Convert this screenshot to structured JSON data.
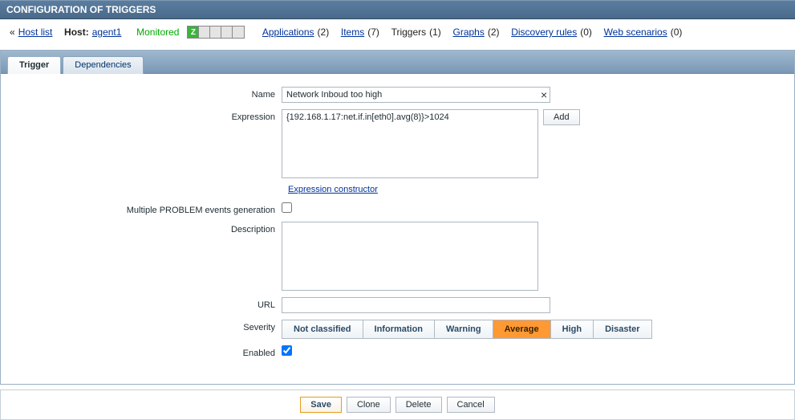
{
  "header": {
    "title": "CONFIGURATION OF TRIGGERS"
  },
  "nav": {
    "back_prefix": "«",
    "host_list": "Host list",
    "host_label": "Host:",
    "host_name": "agent1",
    "status": "Monitored",
    "status_cells": [
      "Z",
      "",
      "",
      "",
      ""
    ],
    "links": {
      "applications": "Applications",
      "applications_count": "(2)",
      "items": "Items",
      "items_count": "(7)",
      "triggers": "Triggers",
      "triggers_count": "(1)",
      "graphs": "Graphs",
      "graphs_count": "(2)",
      "discovery": "Discovery rules",
      "discovery_count": "(0)",
      "web": "Web scenarios",
      "web_count": "(0)"
    }
  },
  "tabs": {
    "trigger": "Trigger",
    "dependencies": "Dependencies"
  },
  "form": {
    "labels": {
      "name": "Name",
      "expression": "Expression",
      "expr_constructor": "Expression constructor",
      "multiple": "Multiple PROBLEM events generation",
      "description": "Description",
      "url": "URL",
      "severity": "Severity",
      "enabled": "Enabled"
    },
    "values": {
      "name": "Network Inboud too high",
      "expression": "{192.168.1.17:net.if.in[eth0].avg(8)}>1024",
      "description": "",
      "url": "",
      "multiple_checked": false,
      "enabled_checked": true
    },
    "add_button": "Add",
    "clear_x": "×",
    "severity": {
      "options": [
        "Not classified",
        "Information",
        "Warning",
        "Average",
        "High",
        "Disaster"
      ],
      "selected": "Average"
    }
  },
  "buttons": {
    "save": "Save",
    "clone": "Clone",
    "delete": "Delete",
    "cancel": "Cancel"
  }
}
